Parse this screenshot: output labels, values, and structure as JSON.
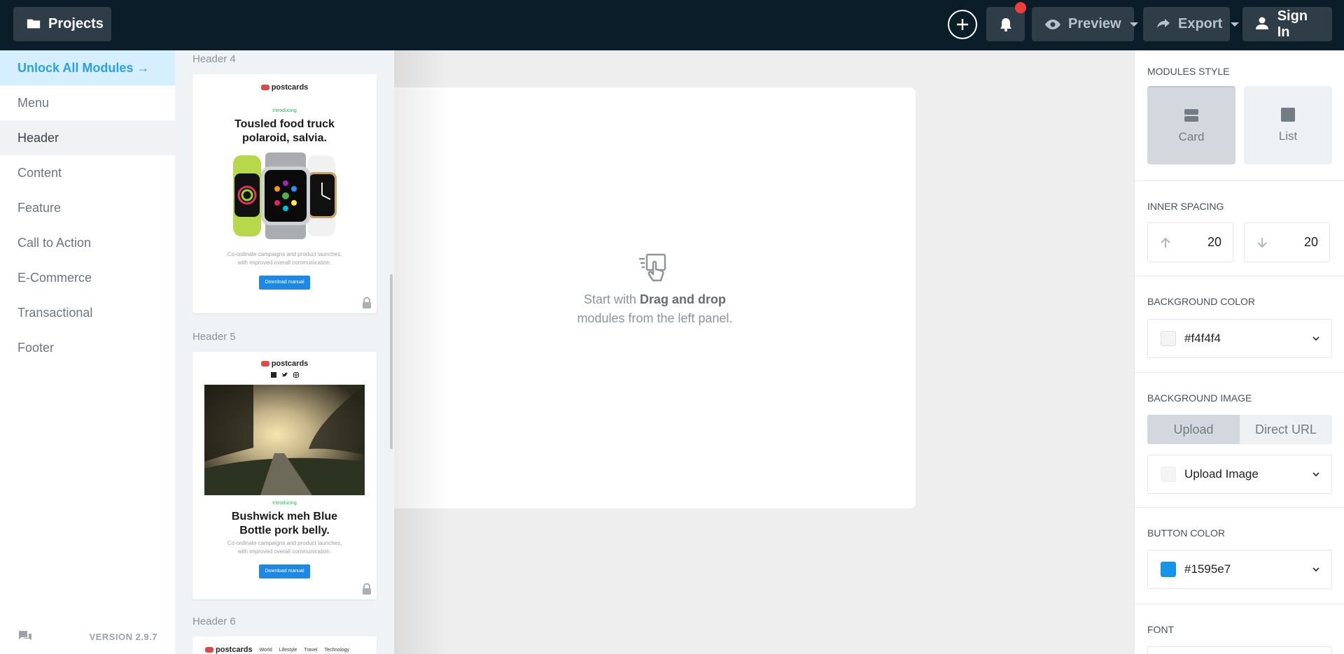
{
  "topbar": {
    "projects_label": "Projects",
    "preview_label": "Preview",
    "export_label": "Export",
    "signin_label": "Sign In"
  },
  "categories": {
    "unlock_label": "Unlock All Modules →",
    "items": [
      "Menu",
      "Header",
      "Content",
      "Feature",
      "Call to Action",
      "E-Commerce",
      "Transactional",
      "Footer"
    ],
    "active": "Header",
    "version": "VERSION 2.9.7"
  },
  "modules": {
    "header4": {
      "label": "Header 4",
      "logo": "postcards",
      "intro": "Introducing",
      "title_line1": "Tousled food truck",
      "title_line2": "polaroid, salvia.",
      "body_line1": "Co-ordinate campaigns and product launches,",
      "body_line2": "with improved overall communication.",
      "button": "Download manual"
    },
    "header5": {
      "label": "Header 5",
      "logo": "postcards",
      "intro": "Introducing",
      "title_line1": "Bushwick meh Blue",
      "title_line2": "Bottle pork belly.",
      "body_line1": "Co-ordinate campaigns and product launches,",
      "body_line2": "with improved overall communication.",
      "button": "Download manual"
    },
    "header6": {
      "label": "Header 6",
      "logo": "postcards",
      "nav": [
        "World",
        "Lifestyle",
        "Travel",
        "Technology"
      ]
    }
  },
  "canvas": {
    "empty_prefix": "Start with ",
    "empty_bold": "Drag and drop",
    "empty_line2": "modules from the left panel."
  },
  "panel": {
    "modules_style": {
      "title": "Modules Style",
      "options": [
        "Card",
        "List"
      ],
      "active": "Card"
    },
    "inner_spacing": {
      "title": "Inner Spacing",
      "top": "20",
      "bottom": "20"
    },
    "background_color": {
      "title": "Background Color",
      "value": "#f4f4f4"
    },
    "background_image": {
      "title": "Background Image",
      "tabs": [
        "Upload",
        "Direct URL"
      ],
      "active": "Upload",
      "select_label": "Upload Image"
    },
    "button_color": {
      "title": "Button Color",
      "value": "#1595e7"
    },
    "font": {
      "title": "Font"
    }
  },
  "colors": {
    "topbar_bg": "#0b1d28",
    "accent": "#2aa1e6",
    "notification": "#f53b3b",
    "button_color": "#1595e7"
  }
}
